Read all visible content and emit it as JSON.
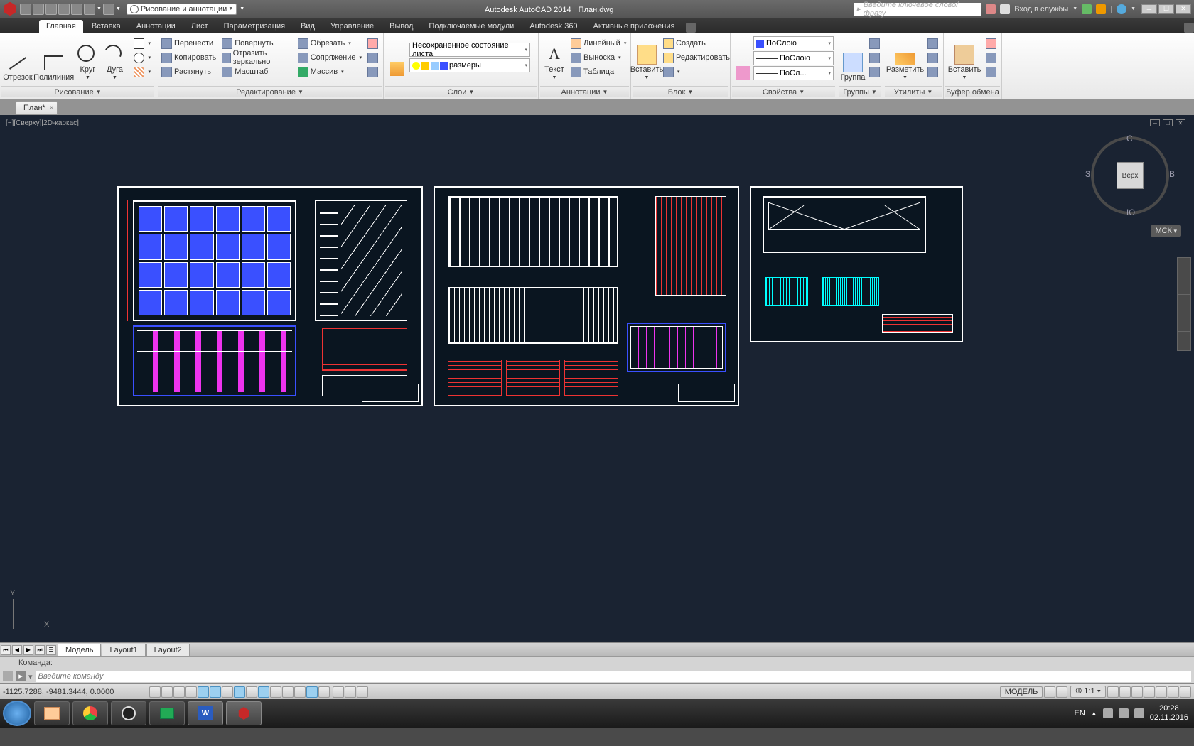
{
  "app": {
    "title": "Autodesk AutoCAD 2014",
    "filename": "План.dwg"
  },
  "workspace": {
    "label": "Рисование и аннотации"
  },
  "search": {
    "placeholder": "Введите ключевое слово/фразу"
  },
  "signin": "Вход в службы",
  "tabs": {
    "main": "Главная",
    "insert": "Вставка",
    "annotate": "Аннотации",
    "sheet": "Лист",
    "param": "Параметризация",
    "view": "Вид",
    "manage": "Управление",
    "output": "Вывод",
    "plugins": "Подключаемые модули",
    "a360": "Autodesk 360",
    "apps": "Активные приложения"
  },
  "ribbon": {
    "draw": {
      "title": "Рисование",
      "line": "Отрезок",
      "pline": "Полилиния",
      "circle": "Круг",
      "arc": "Дуга"
    },
    "modify": {
      "title": "Редактирование",
      "move": "Перенести",
      "copy": "Копировать",
      "stretch": "Растянуть",
      "rotate": "Повернуть",
      "mirror": "Отразить зеркально",
      "scale": "Масштаб",
      "trim": "Обрезать",
      "fillet": "Сопряжение",
      "array": "Массив"
    },
    "layers": {
      "title": "Слои",
      "state": "Несохраненное состояние листа",
      "current": "размеры"
    },
    "annot": {
      "title": "Аннотации",
      "text": "Текст",
      "dim": "Линейный",
      "leader": "Выноска",
      "table": "Таблица"
    },
    "block": {
      "title": "Блок",
      "insert": "Вставить",
      "create": "Создать",
      "edit": "Редактировать"
    },
    "props": {
      "title": "Свойства",
      "bylayer": "ПоСлою",
      "bylayer2": "ПоСлою",
      "bylayer3": "ПоСл..."
    },
    "groups": {
      "title": "Группы",
      "group": "Группа"
    },
    "utils": {
      "title": "Утилиты",
      "measure": "Разметить"
    },
    "clip": {
      "title": "Буфер обмена",
      "paste": "Вставить"
    }
  },
  "doc_tab": "План*",
  "viewport": {
    "label": "[−][Сверху][2D-каркас]",
    "cube_face": "Верх",
    "n": "С",
    "s": "Ю",
    "w": "З",
    "e": "В",
    "wcs": "МСК"
  },
  "layouts": {
    "model": "Модель",
    "l1": "Layout1",
    "l2": "Layout2"
  },
  "cmdline": {
    "history": "Команда:",
    "placeholder": "Введите команду"
  },
  "status": {
    "coords": "-1125.7288, -9481.3444, 0.0000",
    "model": "МОДЕЛЬ",
    "scale": "1:1",
    "lang": "EN"
  },
  "clock": {
    "time": "20:28",
    "date": "02.11.2016"
  }
}
